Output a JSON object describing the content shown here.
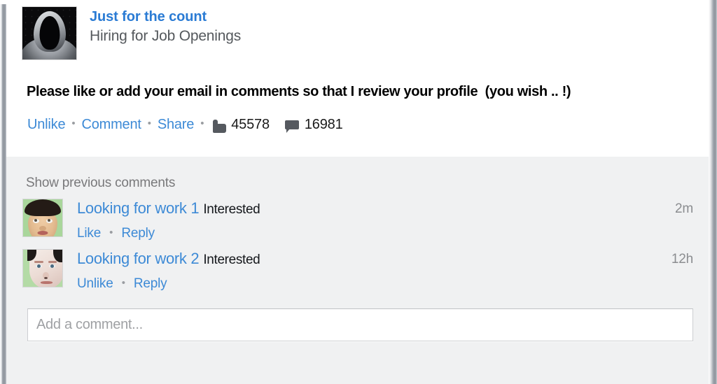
{
  "post": {
    "page_name": "Just for the count",
    "page_subtitle": "Hiring for Job Openings",
    "avatar_icon": "hooded-figure-avatar",
    "body_text": "Please like or add your email in comments so that I review your profile  (you wish .. !)",
    "actions": {
      "like_label": "Unlike",
      "comment_label": "Comment",
      "share_label": "Share",
      "separator": "•",
      "like_icon": "thumbs-up-icon",
      "like_count": "45578",
      "comment_icon": "speech-bubble-icon",
      "comment_count": "16981"
    }
  },
  "comments": {
    "show_previous_label": "Show previous comments",
    "items": [
      {
        "avatar_icon": "face-looking-up-avatar",
        "name": "Looking for work 1",
        "text": "Interested",
        "like_label": "Like",
        "reply_label": "Reply",
        "separator": "•",
        "timestamp": "2m"
      },
      {
        "avatar_icon": "pale-face-avatar",
        "name": "Looking for work 2",
        "text": "Interested",
        "like_label": "Unlike",
        "reply_label": "Reply",
        "separator": "•",
        "timestamp": "12h"
      }
    ],
    "composer_placeholder": "Add a comment...",
    "composer_value": ""
  },
  "colors": {
    "link_blue": "#3d8ad6",
    "page_name_blue": "#2a7bd4",
    "comment_bg": "#f0f1f2",
    "post_bg": "#ffffff",
    "icon_gray": "#55595f",
    "muted_gray": "#8b8d90"
  }
}
